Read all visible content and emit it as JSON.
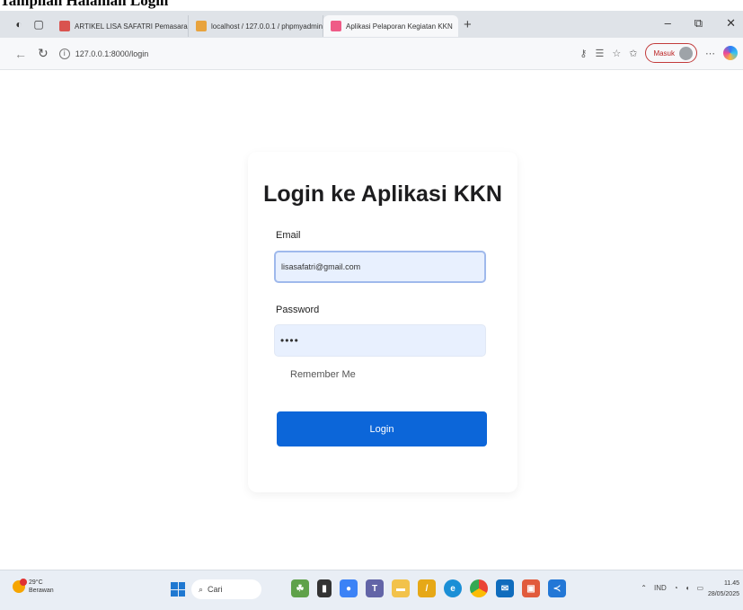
{
  "caption": "Tampilan Halaman Login",
  "browser": {
    "tabs": [
      {
        "label": "ARTIKEL LISA SAFATRI Pemasaran",
        "active": false,
        "favicon_color": "#d9534f"
      },
      {
        "label": "localhost / 127.0.0.1 / phpmyadmin",
        "active": false,
        "favicon_color": "#e8a33d"
      },
      {
        "label": "Aplikasi Pelaporan Kegiatan KKN",
        "active": true,
        "favicon_color": "#ef5b87"
      }
    ],
    "new_tab": "+",
    "url": "127.0.0.1:8000/login",
    "profile_label": "Masuk"
  },
  "login": {
    "title": "Login ke Aplikasi KKN",
    "email_label": "Email",
    "email_value": "lisasafatri@gmail.com",
    "password_label": "Password",
    "password_value": "••••",
    "remember_label": "Remember Me",
    "button_label": "Login"
  },
  "taskbar": {
    "temperature": "29°C",
    "weather": "Berawan",
    "search_placeholder": "Cari",
    "language": "IND",
    "time": "11.45",
    "date": "28/05/2025"
  },
  "colors": {
    "primary_button": "#0c66d9",
    "input_fill": "#e8f0fe"
  }
}
